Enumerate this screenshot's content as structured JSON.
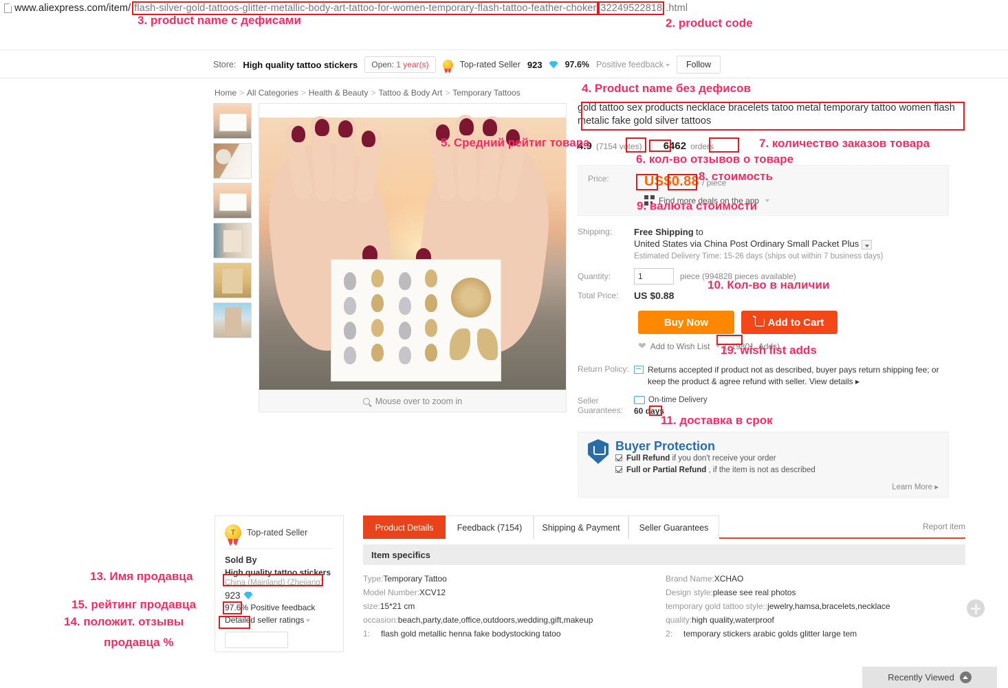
{
  "browser": {
    "url_prefix": "www.aliexpress.com/item/",
    "url_slug": "flash-silver-gold-tattoos-glitter-metallic-body-art-tattoo-for-women-temporary-flash-tattoo-feather-choker",
    "url_product_code": "32249522818",
    "url_suffix": ".html"
  },
  "annotations": [
    {
      "id": "a3",
      "text": "3. product name с дефисами"
    },
    {
      "id": "a2",
      "text": "2. product code"
    },
    {
      "id": "a4",
      "text": "4. Product name без дефисов"
    },
    {
      "id": "a5",
      "text": "5. Средний рейтиг товара"
    },
    {
      "id": "a6",
      "text": "6. кол-во отзывов о товаре"
    },
    {
      "id": "a7",
      "text": "7. количество заказов товара"
    },
    {
      "id": "a8",
      "text": "8. стоимость"
    },
    {
      "id": "a9",
      "text": "9. валюта стоимости"
    },
    {
      "id": "a10",
      "text": "10. Кол-во в наличии"
    },
    {
      "id": "a19",
      "text": "19. wish list adds"
    },
    {
      "id": "a11",
      "text": "11. доставка в срок"
    },
    {
      "id": "a13",
      "text": "13. Имя продавца"
    },
    {
      "id": "a15",
      "text": "15. рейтинг продавца"
    },
    {
      "id": "a14a",
      "text": "14. положит. отзывы"
    },
    {
      "id": "a14b",
      "text": "продавца %"
    }
  ],
  "store_bar": {
    "store_label": "Store:",
    "store_name": "High quality tattoo stickers",
    "open_prefix": "Open:",
    "open_value": "1 year(s)",
    "top_rated_label": "Top-rated Seller",
    "seller_score": "923",
    "positive_pct": "97.6%",
    "positive_label": "Positive feedback",
    "follow_label": "Follow"
  },
  "breadcrumb": [
    "Home",
    "All Categories",
    "Health & Beauty",
    "Tattoo & Body Art",
    "Temporary Tattoos"
  ],
  "gallery": {
    "zoom_hint": "Mouse over to zoom in",
    "thumb_count": 6
  },
  "product": {
    "title": "gold tattoo sex products necklace bracelets tatoo metal temporary tattoo women flash metalic fake gold silver tattoos",
    "rating": "4.9",
    "votes": "(7154 votes)",
    "orders_count": "6462",
    "orders_label": "orders"
  },
  "price": {
    "label": "Price:",
    "currency": "US",
    "symbol": "$",
    "amount": "0.88",
    "per_unit": "/ piece",
    "app_deals": "Find more deals on the app"
  },
  "shipping": {
    "label": "Shipping:",
    "free_text": "Free Shipping",
    "to": "to",
    "route": "United States via China Post Ordinary Small Packet Plus",
    "eta": "Estimated Delivery Time: 15-26 days (ships out within 7 business days)"
  },
  "quantity": {
    "label": "Quantity:",
    "value": "1",
    "unit_hint": "piece (994828 pieces available)",
    "available": "994828"
  },
  "total": {
    "label": "Total Price:",
    "value": "US $0.88"
  },
  "actions": {
    "buy_now": "Buy Now",
    "add_to_cart": "Add to Cart",
    "wish_list": "Add to Wish List",
    "wish_open_paren": "(",
    "wish_adds": "19801",
    "wish_adds_label": "Adds)"
  },
  "return_policy": {
    "label": "Return Policy:",
    "text": "Returns accepted if product not as described, buyer pays return shipping fee; or keep the product & agree refund with seller.",
    "view_details": "View details ▸"
  },
  "seller_guarantees": {
    "label_line1": "Seller",
    "label_line2": "Guarantees:",
    "on_time": "On-time Delivery",
    "days_value": "60",
    "days_label": "days"
  },
  "buyer_protection": {
    "title": "Buyer Protection",
    "item1_bold": "Full Refund",
    "item1_rest": "if you don't receive your order",
    "item2_bold": "Full or Partial Refund",
    "item2_rest": ", if the item is not as described",
    "learn_more": "Learn More ▸"
  },
  "seller_card": {
    "top_rated": "Top-rated Seller",
    "badge_letter": "T",
    "sold_by": "Sold By",
    "name": "High quality tattoo stickers",
    "location": "China (Mainland) (Zhejiang)",
    "score": "923",
    "positive_pct": "97.6%",
    "positive_label": "Positive feedback",
    "detailed_ratings": "Detailed seller ratings"
  },
  "tabs": [
    {
      "label": "Product Details",
      "active": true
    },
    {
      "label": "Feedback (7154)",
      "active": false
    },
    {
      "label": "Shipping & Payment",
      "active": false
    },
    {
      "label": "Seller Guarantees",
      "active": false
    }
  ],
  "report_item": "Report item",
  "item_specifics": {
    "heading": "Item specifics",
    "left": [
      {
        "key": "Type:",
        "val": "Temporary Tattoo"
      },
      {
        "key": "Model Number:",
        "val": "XCV12"
      },
      {
        "key": "size:",
        "val": "15*21 cm"
      },
      {
        "key": "occasion:",
        "val": "beach,party,date,office,outdoors,wedding,gift,makeup"
      }
    ],
    "left_numbered": {
      "num": "1:",
      "val": "flash gold metallic henna fake bodystocking tatoo"
    },
    "right": [
      {
        "key": "Brand Name:",
        "val": "XCHAO"
      },
      {
        "key": "Design style:",
        "val": "please see real photos"
      },
      {
        "key": "temporary gold tattoo style::",
        "val": "jewelry,hamsa,bracelets,necklace"
      },
      {
        "key": "quality:",
        "val": "high quality,waterproof"
      }
    ],
    "right_numbered": {
      "num": "2:",
      "val": "temporary stickers arabic golds glitter large tem"
    }
  },
  "recently_viewed": "Recently Viewed",
  "colors": {
    "highlight_red": "#e8191c",
    "annotation_pink": "#fc2a60",
    "accent_orange": "#ff8800",
    "cart_orange": "#f34718",
    "tab_red": "#e8431a",
    "protection_blue": "#2a6ca8"
  }
}
